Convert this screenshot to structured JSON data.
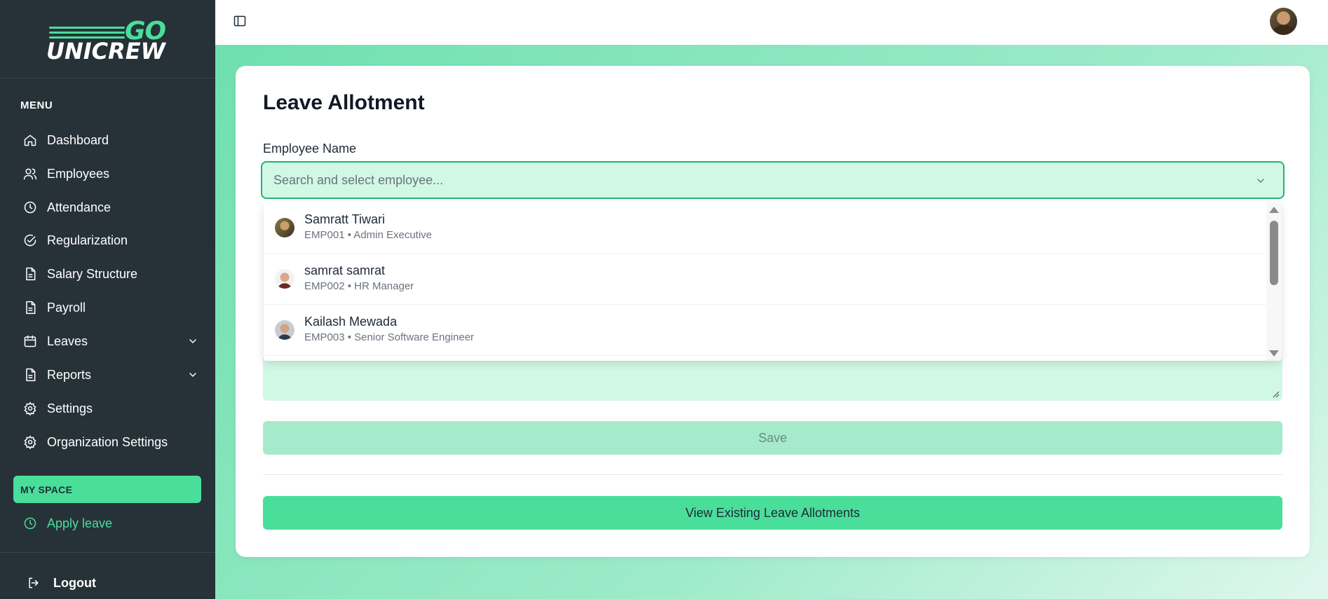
{
  "brand": {
    "logo_top": "GO",
    "logo_bottom": "UNICREW",
    "accent_color": "#4ade9b",
    "sidebar_bg": "#263238"
  },
  "sidebar": {
    "menu_heading": "MENU",
    "items": [
      {
        "label": "Dashboard",
        "icon": "home-icon"
      },
      {
        "label": "Employees",
        "icon": "users-icon"
      },
      {
        "label": "Attendance",
        "icon": "clock-icon"
      },
      {
        "label": "Regularization",
        "icon": "check-circle-icon"
      },
      {
        "label": "Salary Structure",
        "icon": "document-icon"
      },
      {
        "label": "Payroll",
        "icon": "document-icon"
      },
      {
        "label": "Leaves",
        "icon": "calendar-icon",
        "expandable": true
      },
      {
        "label": "Reports",
        "icon": "document-icon",
        "expandable": true
      },
      {
        "label": "Settings",
        "icon": "gear-icon"
      },
      {
        "label": "Organization Settings",
        "icon": "gear-icon"
      }
    ],
    "my_space_heading": "MY SPACE",
    "my_space_items": [
      {
        "label": "Apply leave",
        "icon": "clock-icon"
      }
    ],
    "logout_label": "Logout"
  },
  "header": {
    "toggle_icon": "sidebar-toggle-icon",
    "avatar_icon": "user-avatar"
  },
  "main": {
    "title": "Leave Allotment",
    "employee_field": {
      "label": "Employee Name",
      "placeholder": "Search and select employee...",
      "value": ""
    },
    "dropdown_options": [
      {
        "name": "Samratt Tiwari",
        "subtitle": "EMP001 • Admin Executive"
      },
      {
        "name": "samrat samrat",
        "subtitle": "EMP002 • HR Manager"
      },
      {
        "name": "Kailash Mewada",
        "subtitle": "EMP003 • Senior Software Engineer"
      }
    ],
    "save_label": "Save",
    "view_existing_label": "View Existing Leave Allotments"
  }
}
